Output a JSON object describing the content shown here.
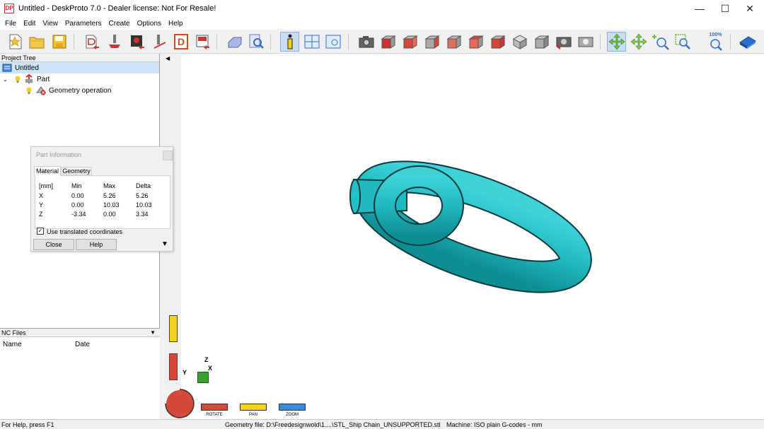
{
  "window": {
    "title": "Untitled - DeskProto 7.0 - Dealer license: Not For Resale!",
    "icon": "DP",
    "minimize": "—",
    "maximize": "☐",
    "close": "✕"
  },
  "menu": [
    "File",
    "Edit",
    "View",
    "Parameters",
    "Create",
    "Options",
    "Help"
  ],
  "toolbar": {
    "zoom_label": "100%"
  },
  "project_tree": {
    "header": "Project Tree",
    "root": "Untitled",
    "part": "Part",
    "operation": "Geometry operation"
  },
  "part_info": {
    "title": "Part Information",
    "tabs": [
      "Material",
      "Geometry"
    ],
    "headers": [
      "[mm]",
      "Min",
      "Max",
      "Delta"
    ],
    "rows": [
      [
        "X",
        "0.00",
        "5.26",
        "5.26"
      ],
      [
        "Y",
        "0.00",
        "10.03",
        "10.03"
      ],
      [
        "Z",
        "-3.34",
        "0.00",
        "3.34"
      ]
    ],
    "checkbox_label": "Use translated coordinates",
    "close_label": "Close",
    "help_label": "Help"
  },
  "nc_files": {
    "header": "NC Files",
    "columns": [
      "Name",
      "Date"
    ]
  },
  "viewport": {
    "axis_x": "X",
    "axis_y": "Y",
    "axis_z": "Z",
    "rotate": "ROTATE",
    "pan": "PAN",
    "zoom": "ZOOM"
  },
  "status": {
    "help": "For Help, press F1",
    "geometry": "Geometry file: D:\\Freedesignwold\\1....\\STL_Ship Chain_UNSUPPORTED.stl",
    "machine": "Machine: ISO plain G-codes - mm"
  },
  "colors": {
    "model": "#1fb9bf",
    "accent": "#c8dcf2"
  }
}
